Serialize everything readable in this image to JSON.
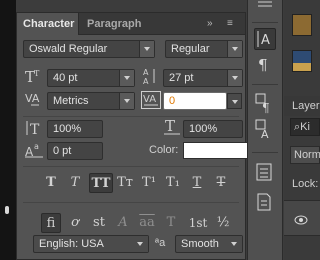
{
  "tabs": [
    "Character",
    "Paragraph"
  ],
  "tab_controls": {
    "collapse": "»",
    "menu": "≡"
  },
  "font_family": "Oswald Regular",
  "font_style": "Regular",
  "size": "40 pt",
  "leading": "27 pt",
  "kerning": "Metrics",
  "tracking": "0",
  "vertical_scale": "100%",
  "horizontal_scale": "100%",
  "baseline_shift": "0 pt",
  "color_label": "Color:",
  "color": "#ffffff",
  "type_buttons": [
    {
      "name": "faux-bold-button",
      "glyph": "T"
    },
    {
      "name": "faux-italic-button",
      "glyph": "T"
    },
    {
      "name": "all-caps-button",
      "glyph": "TT"
    },
    {
      "name": "small-caps-button",
      "glyph": "Tт"
    },
    {
      "name": "superscript-button",
      "glyph": "T¹"
    },
    {
      "name": "subscript-button",
      "glyph": "T₁"
    },
    {
      "name": "underline-button",
      "glyph": "T"
    },
    {
      "name": "strikethrough-button",
      "glyph": "T"
    }
  ],
  "opentype_buttons": [
    {
      "name": "standard-ligatures-button",
      "glyph": "fi"
    },
    {
      "name": "contextual-alternates-button",
      "glyph": "ơ"
    },
    {
      "name": "discretionary-ligatures-button",
      "glyph": "st"
    },
    {
      "name": "swash-button",
      "glyph": "A"
    },
    {
      "name": "stylistic-alternates-button",
      "glyph": "aa"
    },
    {
      "name": "titling-alternates-button",
      "glyph": "T"
    },
    {
      "name": "ordinals-button",
      "glyph": "1st"
    },
    {
      "name": "fractions-button",
      "glyph": "½"
    }
  ],
  "language": "English: USA",
  "aa_label": "ªa",
  "anti_alias": "Smooth",
  "right_panel": {
    "layers_label": "Layer",
    "kind_label": "Ki",
    "blend_label": "Norm",
    "lock_label": "Lock:"
  },
  "colors": {
    "panel_bg": "#535353",
    "field_bg": "#444444",
    "active_field_text": "#e07800"
  }
}
